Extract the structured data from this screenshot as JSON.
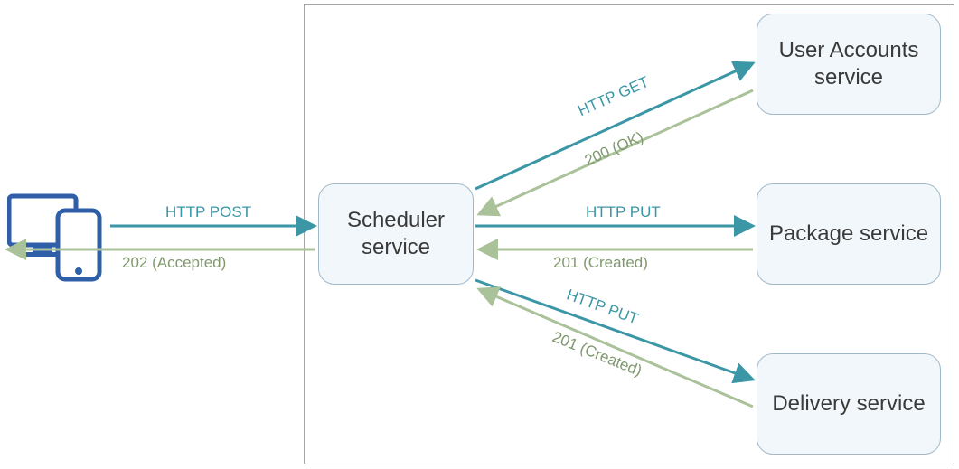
{
  "nodes": {
    "scheduler": "Scheduler service",
    "user_accounts": "User Accounts service",
    "package": "Package service",
    "delivery": "Delivery service"
  },
  "edges": {
    "client_to_scheduler": {
      "request": "HTTP POST",
      "response": "202 (Accepted)"
    },
    "scheduler_to_user_accounts": {
      "request": "HTTP GET",
      "response": "200 (OK)"
    },
    "scheduler_to_package": {
      "request": "HTTP PUT",
      "response": "201 (Created)"
    },
    "scheduler_to_delivery": {
      "request": "HTTP PUT",
      "response": "201 (Created)"
    }
  },
  "colors": {
    "request": "#3b96a6",
    "response": "#aac29a",
    "node_fill": "#f1f7fb",
    "node_border": "#a0b9c9",
    "container_border": "#a6a6a6",
    "device": "#2f5fa8"
  }
}
